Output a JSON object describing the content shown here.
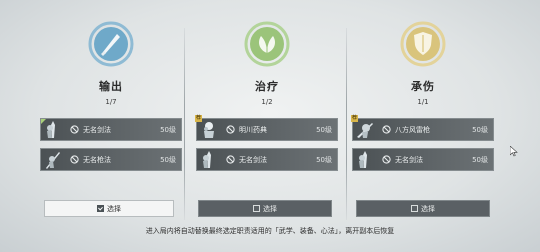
{
  "roles": [
    {
      "title": "输出",
      "count": "1/7",
      "emblem": "blade-icon",
      "accent": "#6fa9c9",
      "cards": [
        {
          "name": "无名剑法",
          "level": "50级",
          "tag": "",
          "thumb": "swordsman-icon"
        },
        {
          "name": "无名枪法",
          "level": "50级",
          "tag": "",
          "thumb": "spearman-icon"
        }
      ],
      "select_label": "选择",
      "selected": true
    },
    {
      "title": "治疗",
      "count": "1/2",
      "emblem": "leaf-icon",
      "accent": "#9bc47a",
      "cards": [
        {
          "name": "明川药典",
          "level": "50级",
          "tag": "荐",
          "thumb": "healer-icon"
        },
        {
          "name": "无名剑法",
          "level": "50级",
          "tag": "",
          "thumb": "swordsman-icon"
        }
      ],
      "select_label": "选择",
      "selected": false
    },
    {
      "title": "承伤",
      "count": "1/1",
      "emblem": "shield-icon",
      "accent": "#d9c47c",
      "cards": [
        {
          "name": "八方风雷枪",
          "level": "50级",
          "tag": "荐",
          "thumb": "tank-icon"
        },
        {
          "name": "无名剑法",
          "level": "50级",
          "tag": "",
          "thumb": "swordsman-icon"
        }
      ],
      "select_label": "选择",
      "selected": false
    }
  ],
  "footer_note": "进入局内将自动替换最终选定职责适用的「武学、装备、心法」，离开副本后恢复"
}
